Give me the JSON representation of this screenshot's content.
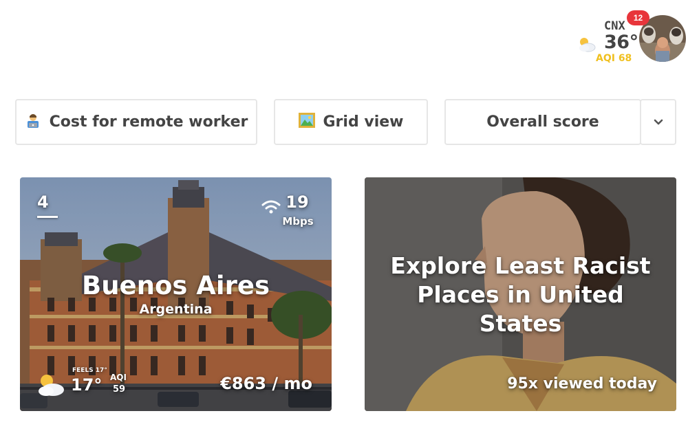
{
  "header": {
    "weather": {
      "city_code": "CNX",
      "temperature": "36°",
      "aqi": "AQI 68",
      "icon": "sun-behind-cloud-icon"
    },
    "profile": {
      "notifications_count": "12",
      "avatar_icon": "avatar-photo"
    }
  },
  "filters": {
    "cost": {
      "label": "Cost for remote worker",
      "icon": "technologist-emoji-icon"
    },
    "view": {
      "label": "Grid view",
      "icon": "framed-picture-emoji-icon"
    },
    "sort": {
      "label": "Overall score",
      "icon": "chevron-down-icon"
    }
  },
  "cards": [
    {
      "rank": "4",
      "internet_speed": "19",
      "internet_unit": "Mbps",
      "city": "Buenos Aires",
      "country": "Argentina",
      "feels_like": "FEELS 17°",
      "temperature": "17°",
      "aqi_label": "AQI",
      "aqi_value": "59",
      "cost": "€863 / mo",
      "weather_icon": "sun-behind-cloud-icon",
      "wifi_icon": "wifi-icon"
    },
    {
      "title": "Explore Least Racist Places in United States",
      "views": "95x viewed today"
    }
  ],
  "colors": {
    "aqi_yellow": "#f0c020",
    "badge_red": "#e8353b",
    "border": "#e6e6e6",
    "text_dark": "#444444"
  }
}
